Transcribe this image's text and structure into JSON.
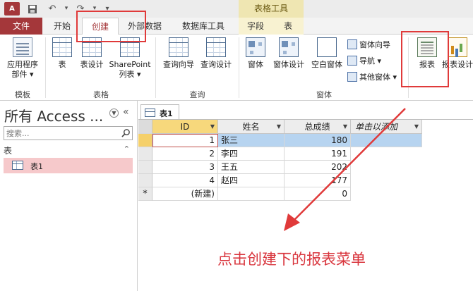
{
  "app": {
    "logo_text": "A"
  },
  "quick_access": {
    "undo_glyph": "↶",
    "redo_glyph": "↷",
    "customize_glyph": "▾"
  },
  "context_tab_group": "表格工具",
  "tabs": {
    "file": "文件",
    "home": "开始",
    "create": "创建",
    "external": "外部数据",
    "dbtools": "数据库工具",
    "fields": "字段",
    "table": "表"
  },
  "ribbon": {
    "templates": {
      "label": "模板",
      "app_parts": "应用程序\n部件 ▾"
    },
    "tables": {
      "label": "表格",
      "table": "表",
      "table_design": "表设计",
      "sharepoint": "SharePoint\n列表 ▾"
    },
    "queries": {
      "label": "查询",
      "wizard": "查询向导",
      "design": "查询设计"
    },
    "forms": {
      "label": "窗体",
      "form": "窗体",
      "form_design": "窗体设计",
      "blank": "空白窗体",
      "wizard": "窗体向导",
      "navigation": "导航 ▾",
      "more": "其他窗体 ▾"
    },
    "reports": {
      "report": "报表",
      "report_design": "报表设计"
    }
  },
  "nav": {
    "title": "所有 Access ...",
    "search_placeholder": "搜索...",
    "group": "表",
    "item": "表1"
  },
  "document": {
    "tab_label": "表1",
    "columns": [
      "ID",
      "姓名",
      "总成绩",
      "单击以添加"
    ],
    "rows": [
      {
        "id": "1",
        "name": "张三",
        "score": "180"
      },
      {
        "id": "2",
        "name": "李四",
        "score": "191"
      },
      {
        "id": "3",
        "name": "王五",
        "score": "202"
      },
      {
        "id": "4",
        "name": "赵四",
        "score": "177"
      }
    ],
    "new_row": {
      "marker": "*",
      "id": "(新建)",
      "score": "0"
    }
  },
  "annotation": {
    "text": "点击创建下的报表菜单",
    "color": "#d9363e"
  }
}
